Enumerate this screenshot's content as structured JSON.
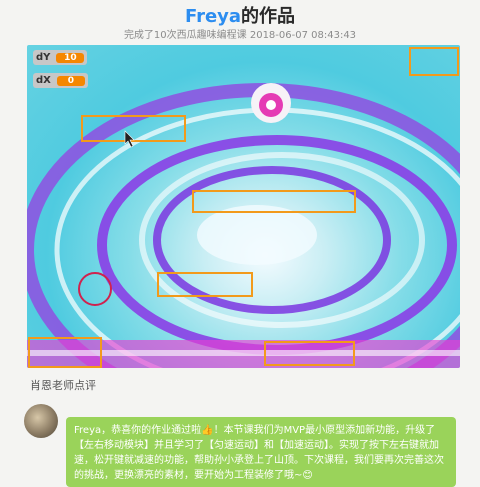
{
  "header": {
    "name": "Freya",
    "title_suffix": "的作品",
    "subtitle": "完成了10次西瓜趣味编程课 2018-06-07 08:43:43"
  },
  "stage": {
    "variables": [
      {
        "label": "dY",
        "value": "10"
      },
      {
        "label": "dX",
        "value": "0"
      }
    ]
  },
  "comment": {
    "section_label": "肖恩老师点评",
    "text": "Freya，恭喜你的作业通过啦👍！本节课我们为MVP最小原型添加新功能，升级了【左右移动模块】并且学习了【匀速运动】和【加速运动】。实现了按下左右键就加速，松开键就减速的功能，帮助孙小承登上了山顶。下次课程，我们要再次完善这次的挑战，更换漂亮的素材，要开始为工程装修了哦~😊"
  },
  "colors": {
    "accent": "#2c8df0",
    "bubble": "#9ad35a",
    "variable": "#f58700"
  }
}
